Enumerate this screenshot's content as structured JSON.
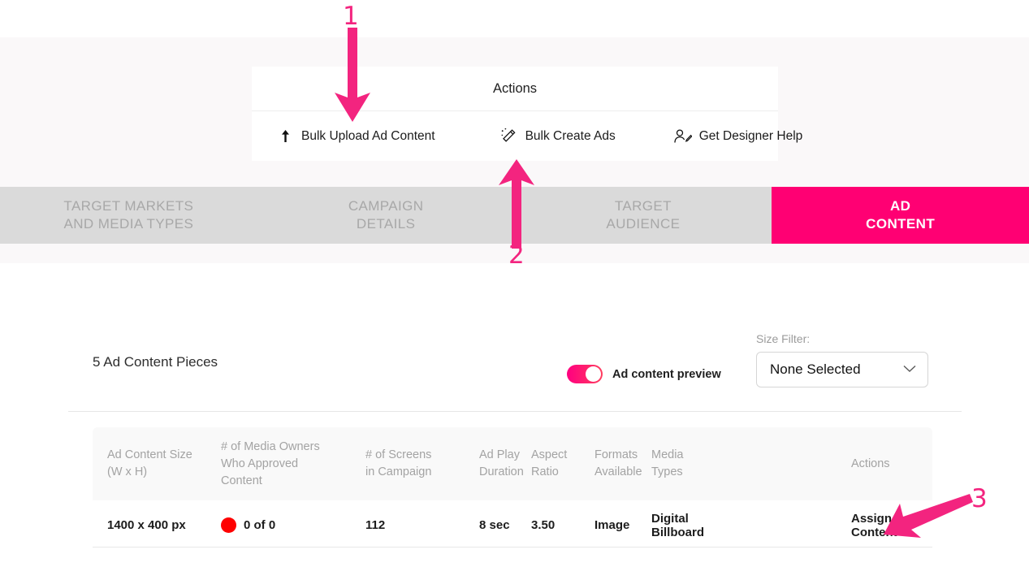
{
  "actions_card": {
    "title": "Actions",
    "items": [
      {
        "icon": "upload-arrow-icon",
        "label": "Bulk Upload Ad Content"
      },
      {
        "icon": "magic-wand-icon",
        "label": "Bulk Create Ads"
      },
      {
        "icon": "designer-person-icon",
        "label": "Get Designer Help"
      }
    ]
  },
  "steps": [
    {
      "line1": "TARGET MARKETS",
      "line2": "AND MEDIA TYPES",
      "active": false
    },
    {
      "line1": "CAMPAIGN",
      "line2": "DETAILS",
      "active": false
    },
    {
      "line1": "TARGET",
      "line2": "AUDIENCE",
      "active": false
    },
    {
      "line1": "AD",
      "line2": "CONTENT",
      "active": true
    }
  ],
  "main": {
    "pieces_title": "5 Ad Content Pieces",
    "preview_toggle_label": "Ad content preview",
    "size_filter_label": "Size Filter:",
    "size_filter_value": "None Selected",
    "chevron": "chevron-down-icon"
  },
  "table": {
    "headers": {
      "size": "Ad Content Size\n(W x H)",
      "size_l1": "Ad Content Size",
      "size_l2": "(W x H)",
      "approved_l1": "# of Media Owners",
      "approved_l2": "Who Approved",
      "approved_l3": "Content",
      "screens_l1": "# of Screens",
      "screens_l2": "in Campaign",
      "duration_l1": "Ad Play",
      "duration_l2": "Duration",
      "ratio_l1": "Aspect",
      "ratio_l2": "Ratio",
      "formats_l1": "Formats",
      "formats_l2": "Available",
      "media_l1": "Media",
      "media_l2": "Types",
      "actions": "Actions"
    },
    "rows": [
      {
        "size": "1400 x 400 px",
        "approved": "0 of 0",
        "approved_status_color": "#fe0000",
        "screens": "112",
        "duration": "8 sec",
        "ratio": "3.50",
        "formats": "Image",
        "media_types": "Digital Billboard",
        "action": "Assign Content"
      }
    ]
  },
  "annotations": {
    "accent_color": "#f3247f",
    "markers": [
      {
        "number": "1",
        "points_to": "Bulk Upload Ad Content",
        "direction": "down"
      },
      {
        "number": "2",
        "points_to": "Bulk Create Ads",
        "direction": "up"
      },
      {
        "number": "3",
        "points_to": "Assign Content",
        "direction": "up-left"
      }
    ]
  },
  "colors": {
    "active_step": "#ff0073",
    "step_bar": "#dadada",
    "band": "#faf8f9"
  }
}
